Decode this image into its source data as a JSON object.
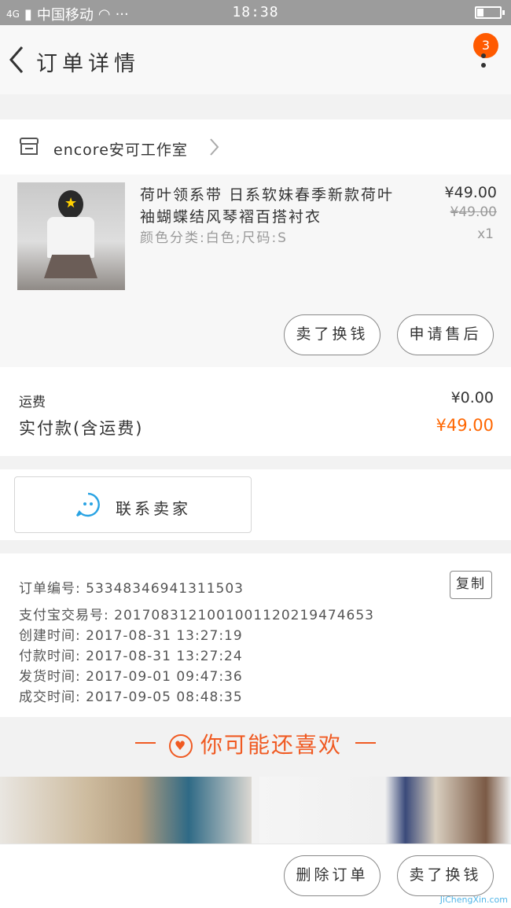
{
  "status_bar": {
    "carrier": "中国移动",
    "signal": "4G",
    "time": "18:38",
    "battery_level": 0.25
  },
  "nav": {
    "title": "订单详情",
    "badge": "3"
  },
  "shop": {
    "name": "encore安可工作室"
  },
  "item": {
    "title": "荷叶领系带 日系软妹春季新款荷叶袖蝴蝶结风琴褶百搭衬衣",
    "spec": "颜色分类:白色;尺码:S",
    "price": "¥49.00",
    "original_price": "¥49.00",
    "quantity": "x1",
    "buttons": {
      "sell_for_cash": "卖了换钱",
      "after_sales": "申请售后"
    }
  },
  "fees": {
    "shipping_label": "运费",
    "shipping_value": "¥0.00",
    "paid_label": "实付款(含运费)",
    "paid_value": "¥49.00"
  },
  "contact": {
    "label": "联系卖家"
  },
  "order_info": {
    "order_no": "订单编号: 53348346941311503",
    "alipay_no": "支付宝交易号: 2017083121001001120219474653",
    "created": "创建时间: 2017-08-31 13:27:19",
    "paid": "付款时间: 2017-08-31 13:27:24",
    "shipped": "发货时间: 2017-09-01 09:47:36",
    "completed": "成交时间: 2017-09-05 08:48:35",
    "copy_label": "复制"
  },
  "recommend": {
    "title": "你可能还喜欢"
  },
  "bottom": {
    "delete_label": "删除订单",
    "sell_label": "卖了换钱"
  },
  "watermark": "JiChengXin.com",
  "colors": {
    "accent": "#ff6600",
    "status_bar": "#9c9c9c",
    "badge": "#ff5a00",
    "icon_blue": "#29a3e3"
  }
}
